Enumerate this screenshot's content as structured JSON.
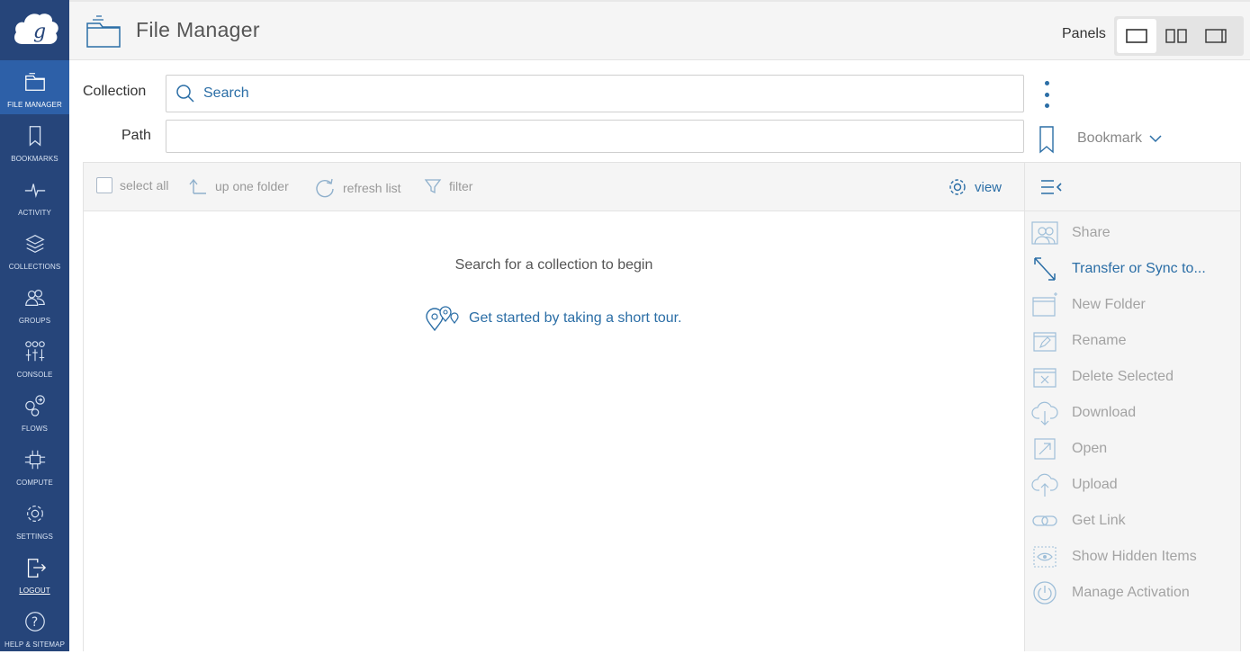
{
  "sidebar": {
    "items": [
      {
        "label": "FILE MANAGER",
        "icon": "folder-icon"
      },
      {
        "label": "BOOKMARKS",
        "icon": "bookmark-icon"
      },
      {
        "label": "ACTIVITY",
        "icon": "activity-icon"
      },
      {
        "label": "COLLECTIONS",
        "icon": "layers-icon"
      },
      {
        "label": "GROUPS",
        "icon": "groups-icon"
      },
      {
        "label": "CONSOLE",
        "icon": "sliders-icon"
      },
      {
        "label": "FLOWS",
        "icon": "flows-icon"
      },
      {
        "label": "COMPUTE",
        "icon": "chip-icon"
      },
      {
        "label": "SETTINGS",
        "icon": "gear-icon"
      },
      {
        "label": "LOGOUT",
        "icon": "logout-icon"
      },
      {
        "label": "HELP & SITEMAP",
        "icon": "help-icon"
      }
    ]
  },
  "header": {
    "title": "File Manager",
    "panels_label": "Panels"
  },
  "form": {
    "collection_label": "Collection",
    "search_placeholder": "Search",
    "path_label": "Path",
    "path_value": "",
    "bookmark_label": "Bookmark"
  },
  "toolbar": {
    "select_all": "select all",
    "up_one_folder": "up one folder",
    "refresh_list": "refresh list",
    "filter": "filter",
    "view": "view"
  },
  "content": {
    "empty_message": "Search for a collection to begin",
    "tour_link": "Get started by taking a short tour."
  },
  "actions": [
    {
      "label": "Share",
      "icon": "share-icon",
      "enabled": false
    },
    {
      "label": "Transfer or Sync to...",
      "icon": "transfer-icon",
      "enabled": true
    },
    {
      "label": "New Folder",
      "icon": "new-folder-icon",
      "enabled": false
    },
    {
      "label": "Rename",
      "icon": "rename-icon",
      "enabled": false
    },
    {
      "label": "Delete Selected",
      "icon": "delete-icon",
      "enabled": false
    },
    {
      "label": "Download",
      "icon": "download-icon",
      "enabled": false
    },
    {
      "label": "Open",
      "icon": "open-icon",
      "enabled": false
    },
    {
      "label": "Upload",
      "icon": "upload-icon",
      "enabled": false
    },
    {
      "label": "Get Link",
      "icon": "link-icon",
      "enabled": false
    },
    {
      "label": "Show Hidden Items",
      "icon": "eye-icon",
      "enabled": false
    },
    {
      "label": "Manage Activation",
      "icon": "power-icon",
      "enabled": false
    }
  ],
  "colors": {
    "sidebar_bg": "#26457a",
    "sidebar_active": "#2d60a8",
    "accent": "#2b6ea6"
  }
}
